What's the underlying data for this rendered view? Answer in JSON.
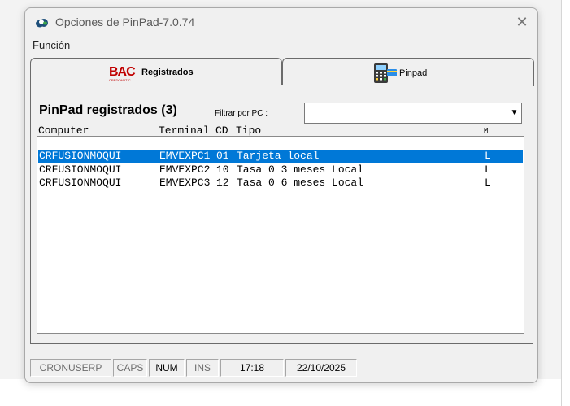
{
  "window": {
    "title": "Opciones de PinPad-7.0.74",
    "close_glyph": "✕"
  },
  "menu": {
    "items": [
      "Función"
    ]
  },
  "tabs": [
    {
      "label": "Registrados",
      "logo_text": "BAC",
      "logo_subtext": "CREDOMATIC",
      "icon": "bac-logo",
      "active": true
    },
    {
      "label": "Pinpad",
      "icon": "pinpad-terminal-icon",
      "active": false
    }
  ],
  "registered": {
    "title": "PinPad registrados (3)",
    "filter_label": "Filtrar por PC :",
    "filter_value": "",
    "filter_arrow": "▼",
    "columns": [
      "Computer",
      "Terminal",
      "CD",
      "Tipo",
      "M"
    ],
    "rows": [
      {
        "computer": "CRFUSIONMOQUI",
        "terminal": "EMVEXPC1",
        "cd": "01",
        "tipo": "Tarjeta local",
        "m": "L",
        "selected": true
      },
      {
        "computer": "CRFUSIONMOQUI",
        "terminal": "EMVEXPC2",
        "cd": "10",
        "tipo": "Tasa 0 3 meses Local",
        "m": "L",
        "selected": false
      },
      {
        "computer": "CRFUSIONMOQUI",
        "terminal": "EMVEXPC3",
        "cd": "12",
        "tipo": "Tasa 0 6 meses Local",
        "m": "L",
        "selected": false
      }
    ]
  },
  "status": {
    "user": "CRONUSERP",
    "caps": "CAPS",
    "num": "NUM",
    "ins": "INS",
    "time": "17:18",
    "date": "22/10/2025"
  },
  "colors": {
    "selection": "#0078d7",
    "bac_red": "#c00000"
  }
}
